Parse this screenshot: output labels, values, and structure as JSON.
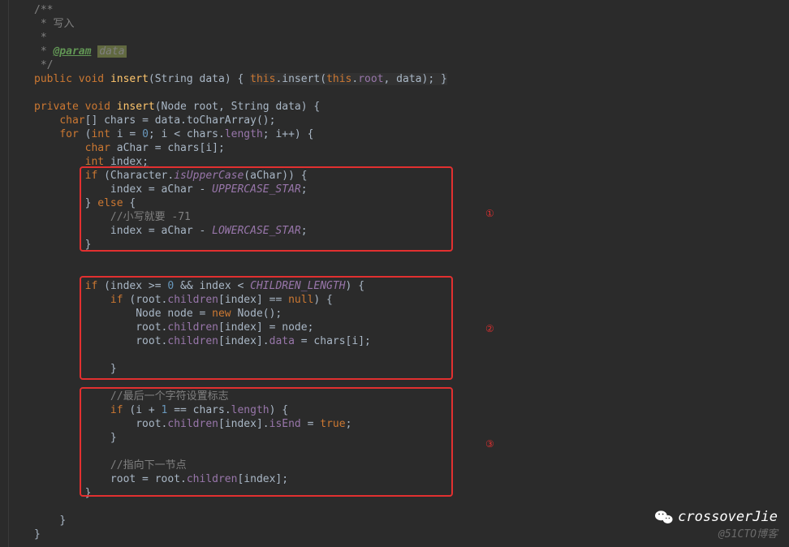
{
  "comment": {
    "open": "/**",
    "line1": " * 写入",
    "line2": " *",
    "line3_pre": " * ",
    "line3_param": "@param",
    "line3_sep": " ",
    "line3_data": "data",
    "close": " */"
  },
  "pub": {
    "kw_public": "public ",
    "kw_void": "void ",
    "method": "insert",
    "sig": "(String data) { ",
    "kw_this1": "this",
    "dot1": ".",
    "call": "insert",
    "paren1": "(",
    "kw_this2": "this",
    "dot2": ".",
    "field": "root",
    "rest": ", data); ",
    "brace": "}"
  },
  "priv": {
    "kw_private": "private ",
    "kw_void": "void ",
    "method": "insert",
    "sig": "(Node root, String data) {"
  },
  "l7": {
    "pre": "    ",
    "kw": "char",
    "rest": "[] chars = data.toCharArray();"
  },
  "l8": {
    "pre": "    ",
    "kw_for": "for ",
    "p1": "(",
    "kw_int": "int ",
    "v1": "i = ",
    "n0": "0",
    "v2": "; i < chars.",
    "field": "length",
    "v3": "; i++) {"
  },
  "l9": {
    "pre": "        ",
    "kw": "char ",
    "rest": "aChar = chars[i];"
  },
  "l10": {
    "pre": "        ",
    "kw": "int ",
    "rest": "index;"
  },
  "l11": {
    "pre": "        ",
    "kw_if": "if ",
    "p1": "(Character.",
    "method": "isUpperCase",
    "p2": "(aChar)) {"
  },
  "l12": {
    "pre": "            ",
    "v1": "index = aChar - ",
    "const": "UPPERCASE_STAR",
    "semi": ";"
  },
  "l13": {
    "pre": "        ",
    "brace": "} ",
    "kw": "else ",
    "open": "{"
  },
  "l14": {
    "pre": "            ",
    "comment": "//小写就要 -71"
  },
  "l15": {
    "pre": "            ",
    "v1": "index = aChar - ",
    "const": "LOWERCASE_STAR",
    "semi": ";"
  },
  "l16": {
    "pre": "        ",
    "brace": "}"
  },
  "l18": {
    "pre": "        ",
    "kw_if": "if ",
    "p1": "(index >= ",
    "n0": "0 ",
    "op": "&& index < ",
    "const": "CHILDREN_LENGTH",
    "p2": ") {"
  },
  "l19": {
    "pre": "            ",
    "kw_if": "if ",
    "p1": "(root.",
    "field": "children",
    "p2": "[index] == ",
    "kw_null": "null",
    "p3": ") {"
  },
  "l20": {
    "pre": "                ",
    "v1": "Node node = ",
    "kw": "new ",
    "v2": "Node();"
  },
  "l21": {
    "pre": "                ",
    "v1": "root.",
    "field": "children",
    "v2": "[index] = node;"
  },
  "l22": {
    "pre": "                ",
    "v1": "root.",
    "field1": "children",
    "v2": "[index].",
    "field2": "data",
    "v3": " = chars[i];"
  },
  "l24": {
    "pre": "            ",
    "brace": "}"
  },
  "l26": {
    "pre": "            ",
    "comment": "//最后一个字符设置标志"
  },
  "l27": {
    "pre": "            ",
    "kw_if": "if ",
    "p1": "(i + ",
    "n1": "1 ",
    "op": "== chars.",
    "field": "length",
    "p2": ") {"
  },
  "l28": {
    "pre": "                ",
    "v1": "root.",
    "field1": "children",
    "v2": "[index].",
    "field2": "isEnd",
    "v3": " = ",
    "kw": "true",
    "semi": ";"
  },
  "l29": {
    "pre": "            ",
    "brace": "}"
  },
  "l31": {
    "pre": "            ",
    "comment": "//指向下一节点"
  },
  "l32": {
    "pre": "            ",
    "v1": "root = root.",
    "field": "children",
    "v2": "[index];"
  },
  "l33": {
    "pre": "        ",
    "brace": "}"
  },
  "l35": {
    "pre": "    ",
    "brace": "}"
  },
  "l36": {
    "brace": "}"
  },
  "markers": {
    "m1": "①",
    "m2": "②",
    "m3": "③"
  },
  "watermark": {
    "top": "crossoverJie",
    "bot": "@51CTO博客"
  }
}
